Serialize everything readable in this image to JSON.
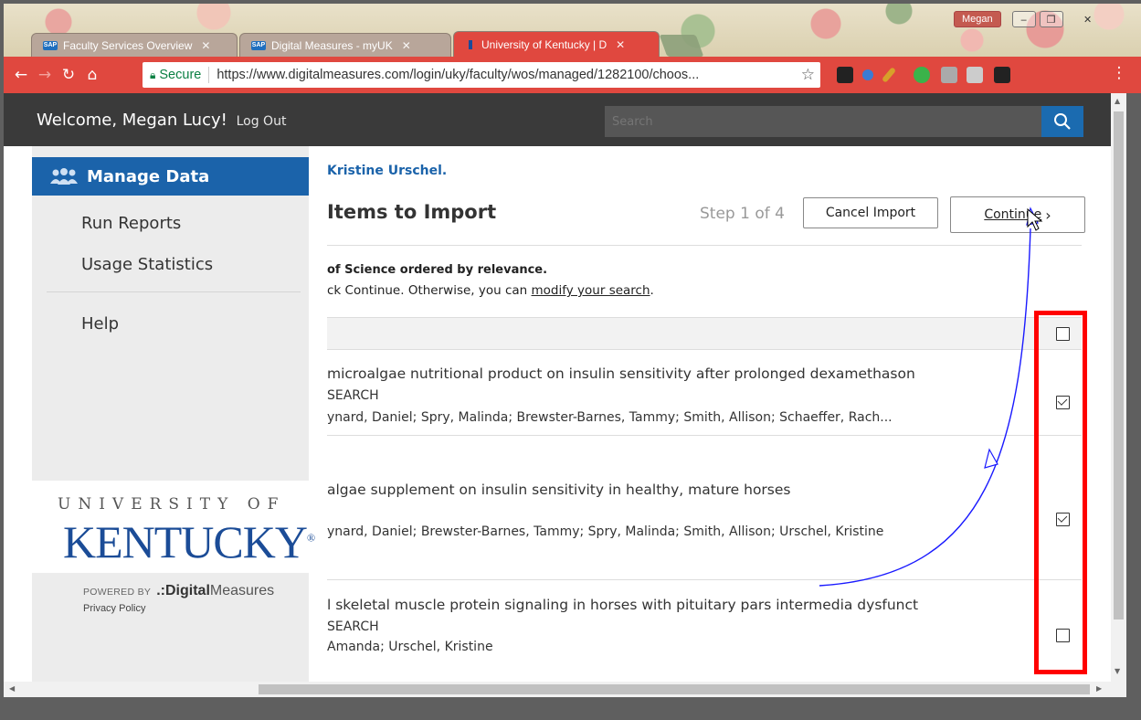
{
  "browser": {
    "tabs": [
      {
        "label": "Faculty Services Overview",
        "favicon": "SAP"
      },
      {
        "label": "Digital Measures - myUK",
        "favicon": "SAP"
      },
      {
        "label": "University of Kentucky | D",
        "favicon": "uk"
      }
    ],
    "profile_name": "Megan",
    "secure_label": "Secure",
    "url": "https://www.digitalmeasures.com/login/uky/faculty/wos/managed/1282100/choos..."
  },
  "header": {
    "welcome": "Welcome, Megan Lucy!",
    "logout": "Log Out",
    "search_placeholder": "Search"
  },
  "sidebar": {
    "items": [
      {
        "label": "Manage Data",
        "icon": "people-icon"
      },
      {
        "label": "Run Reports"
      },
      {
        "label": "Usage Statistics"
      },
      {
        "label": "Help"
      }
    ],
    "university_line": "UNIVERSITY OF",
    "kentucky": "KENTUCKY",
    "powered_by": "POWERED BY",
    "dm_bold": "Digital",
    "dm_light": "Measures",
    "privacy": "Privacy Policy"
  },
  "main": {
    "owner": "Kristine Urschel.",
    "title": "Items to Import",
    "step": "Step 1 of 4",
    "cancel_button": "Cancel Import",
    "continue_button": "Continue",
    "continue_chevron": "›",
    "info_bold": "of Science ordered by relevance.",
    "info_prefix": "ck Continue. Otherwise, you can",
    "info_link": "modify your search",
    "info_suffix": ".",
    "rows": [
      {
        "title": "microalgae nutritional product on insulin sensitivity after prolonged dexamethason",
        "journal": "SEARCH",
        "authors": "ynard, Daniel; Spry, Malinda; Brewster-Barnes, Tammy; Smith, Allison; Schaeffer, Rach...",
        "checked": true
      },
      {
        "title": "algae supplement on insulin sensitivity in healthy, mature horses",
        "journal": "",
        "authors": "ynard, Daniel; Brewster-Barnes, Tammy; Spry, Malinda; Smith, Allison; Urschel, Kristine",
        "checked": true
      },
      {
        "title": "l skeletal muscle protein signaling in horses with pituitary pars intermedia dysfunct",
        "journal": "SEARCH",
        "authors": "Amanda; Urschel, Kristine",
        "checked": false
      }
    ],
    "select_all_checked": false
  },
  "colors": {
    "accent": "#1b63aa",
    "header": "#3a3a3a",
    "browser_toolbar": "#e0483f",
    "annotation_box": "#ff0000",
    "annotation_arrow": "#1a1aff"
  }
}
